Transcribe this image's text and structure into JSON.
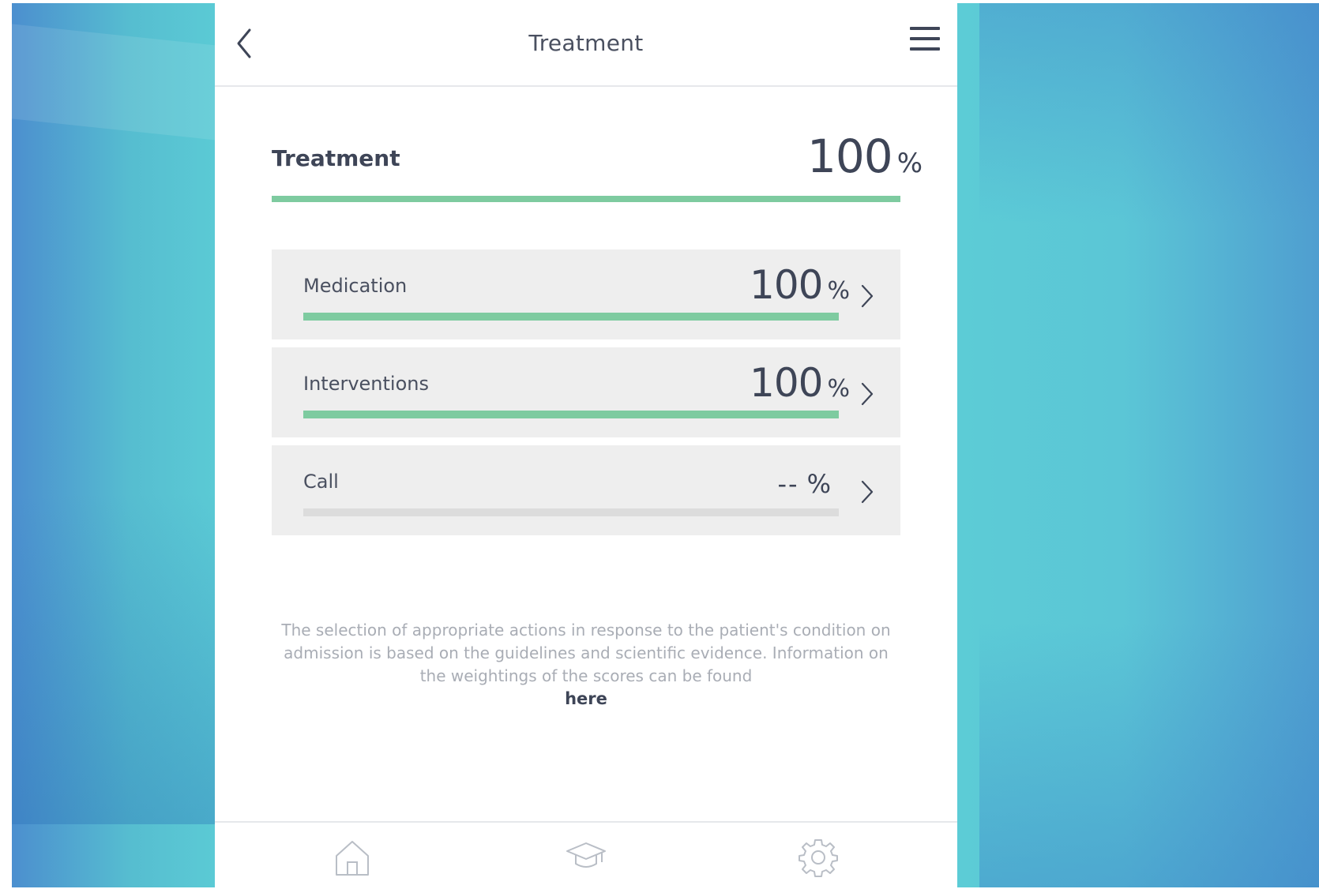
{
  "header": {
    "title": "Treatment"
  },
  "summary": {
    "label": "Treatment",
    "value": "100",
    "unit": "%",
    "progress": 1.0
  },
  "categories": [
    {
      "label": "Medication",
      "value": "100",
      "unit": "%",
      "progress": 1.0
    },
    {
      "label": "Interventions",
      "value": "100",
      "unit": "%",
      "progress": 1.0
    },
    {
      "label": "Call",
      "value": "--",
      "unit": "%",
      "progress": 0.0
    }
  ],
  "info": {
    "text": "The selection of appropriate actions in response to the patient's condition on admission is based on the guidelines and scientific evidence. Information on the weightings of the scores can be found",
    "link": "here"
  },
  "footer_nav": {
    "items": [
      "home-icon",
      "graduation-cap-icon",
      "gear-icon"
    ]
  },
  "colors": {
    "accent": "#7ecba0",
    "text": "#3e4557",
    "card_bg": "#eeeeee"
  }
}
